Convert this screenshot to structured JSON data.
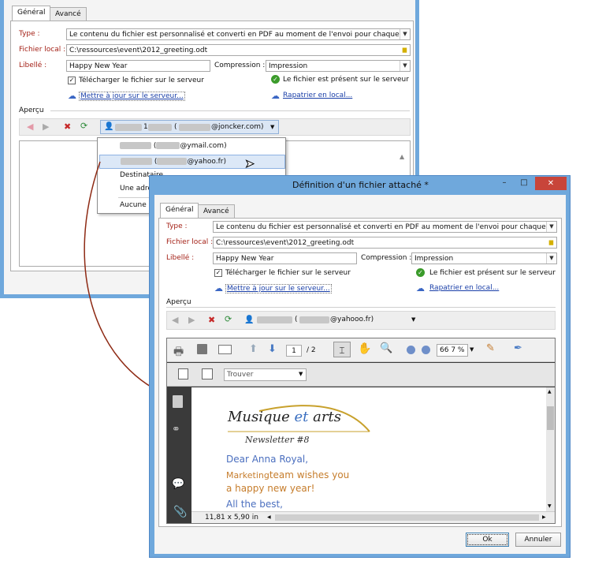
{
  "back_window": {
    "tabs": [
      {
        "label": "Général"
      },
      {
        "label": "Avancé"
      }
    ],
    "type_label": "Type :",
    "type_value": "Le contenu du fichier est personnalisé et converti en PDF au moment de l'envoi pour chaque mes...",
    "file_label": "Fichier local :",
    "file_value": "C:\\ressources\\event\\2012_greeting.odt",
    "label_label": "Libellé :",
    "label_value": "Happy New Year",
    "compression_label": "Compression :",
    "compression_value": "Impression",
    "upload_label": "Télécharger le fichier sur le serveur",
    "present_label": "Le fichier est présent sur le serveur",
    "update_link": "Mettre à jour sur le serveur...",
    "repatriate_link": "Rapatrier en local...",
    "preview_label": "Aperçu",
    "recipient_selected": "@joncker.com)",
    "recipient_num": "1",
    "dropdown": {
      "items": [
        {
          "label": "@ymail.com)"
        },
        {
          "label": "@yahoo.fr)"
        },
        {
          "label": "Destinataire..."
        },
        {
          "label": "Une adres"
        },
        {
          "label": "Aucune p"
        }
      ]
    }
  },
  "front_window": {
    "title": "Définition d'un fichier attaché *",
    "controls": {
      "minimize": "–",
      "maximize": "□",
      "close": "✕"
    },
    "tabs": [
      {
        "label": "Général"
      },
      {
        "label": "Avancé"
      }
    ],
    "type_label": "Type :",
    "type_value": "Le contenu du fichier est personnalisé et converti en PDF au moment de l'envoi pour chaque mes...",
    "file_label": "Fichier local :",
    "file_value": "C:\\ressources\\event\\2012_greeting.odt",
    "label_label": "Libellé :",
    "label_value": "Happy New Year",
    "compression_label": "Compression :",
    "compression_value": "Impression",
    "upload_label": "Télécharger le fichier sur le serveur",
    "present_label": "Le fichier est présent sur le serveur",
    "update_link": "Mettre à jour sur le serveur...",
    "repatriate_link": "Rapatrier en local...",
    "preview_label": "Aperçu",
    "recipient_value": "@yahooo.fr)",
    "pdf": {
      "page_current": "1",
      "page_total": "/ 2",
      "zoom": "66 7 %",
      "search_placeholder": "Trouver",
      "page_size": "11,81 x 5,90 in",
      "doc": {
        "brand_a": "Musique ",
        "brand_b": "et",
        "brand_c": " arts",
        "newsletter": "Newsletter #8",
        "line1": "Dear  Anna Royal,",
        "line2a": "Marketing",
        "line2b": "team wishes you",
        "line3": "a happy new year!",
        "line4": "All the best,"
      }
    },
    "ok_label": "Ok",
    "cancel_label": "Annuler"
  },
  "colors": {
    "window_border": "#6fa8dc",
    "label_red": "#a42117",
    "link_blue": "#1a3fa8",
    "pdf_dark": "#3a3a3a",
    "brand_gold": "#c8a12c",
    "text_blue": "#4b6fbf",
    "text_orange": "#c67d2c",
    "arrow": "#8e2a14"
  }
}
